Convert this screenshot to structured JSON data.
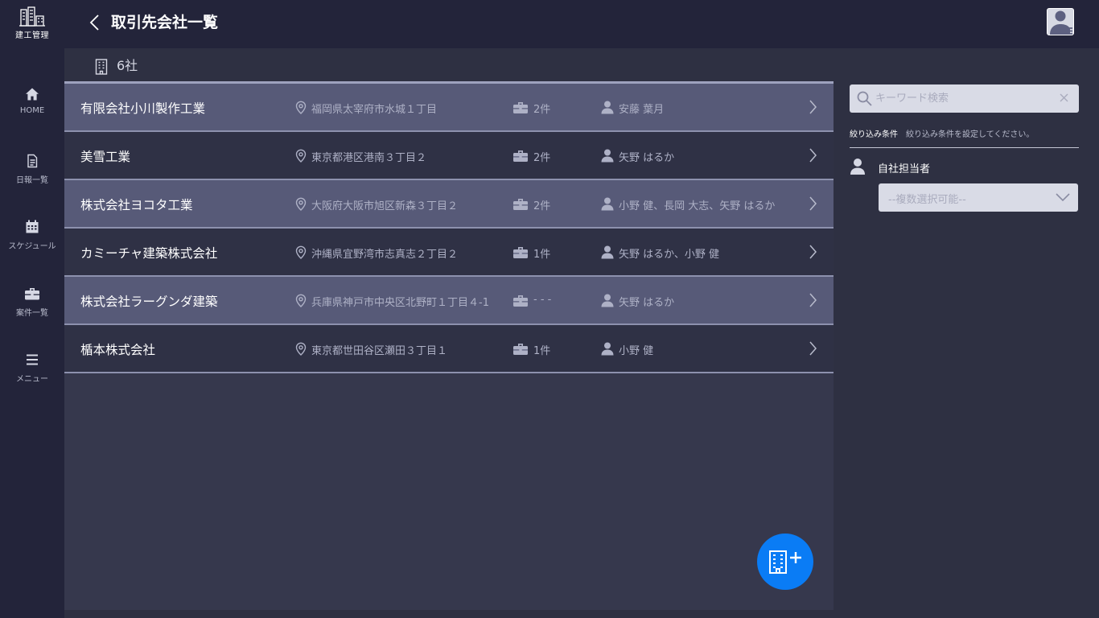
{
  "app": {
    "logo_text": "建工管理",
    "page_title": "取引先会社一覧"
  },
  "sidebar": {
    "items": [
      {
        "label": "HOME",
        "icon": "home-icon"
      },
      {
        "label": "日報一覧",
        "icon": "document-icon"
      },
      {
        "label": "スケジュール",
        "icon": "calendar-icon"
      },
      {
        "label": "案件一覧",
        "icon": "briefcase-icon"
      },
      {
        "label": "メニュー",
        "icon": "menu-icon"
      }
    ]
  },
  "summary": {
    "count_text": "6社"
  },
  "companies": [
    {
      "name": "有限会社小川製作工業",
      "address": "福岡県太宰府市水城１丁目",
      "cases": "2件",
      "staff": "安藤 葉月"
    },
    {
      "name": "美雪工業",
      "address": "東京都港区港南３丁目２",
      "cases": "2件",
      "staff": "矢野 はるか"
    },
    {
      "name": "株式会社ヨコタ工業",
      "address": "大阪府大阪市旭区新森３丁目２",
      "cases": "2件",
      "staff": "小野 健、長岡 大志、矢野 はるか"
    },
    {
      "name": "カミーチャ建築株式会社",
      "address": "沖縄県宜野湾市志真志２丁目２",
      "cases": "1件",
      "staff": "矢野 はるか、小野 健"
    },
    {
      "name": "株式会社ラーグンダ建築",
      "address": "兵庫県神戸市中央区北野町１丁目４-1",
      "cases": "- - -",
      "staff": "矢野 はるか"
    },
    {
      "name": "楯本株式会社",
      "address": "東京都世田谷区瀬田３丁目１",
      "cases": "1件",
      "staff": "小野 健"
    }
  ],
  "filter": {
    "search_placeholder": "キーワード検索",
    "label": "絞り込み条件",
    "description": "絞り込み条件を設定してください。",
    "staff_label": "自社担当者",
    "staff_select_placeholder": "--複数選択可能--"
  },
  "colors": {
    "accent": "#0a7cf5",
    "header_bg": "#23243a",
    "row_alt": "#575a78",
    "row_plain": "#2f3145"
  }
}
